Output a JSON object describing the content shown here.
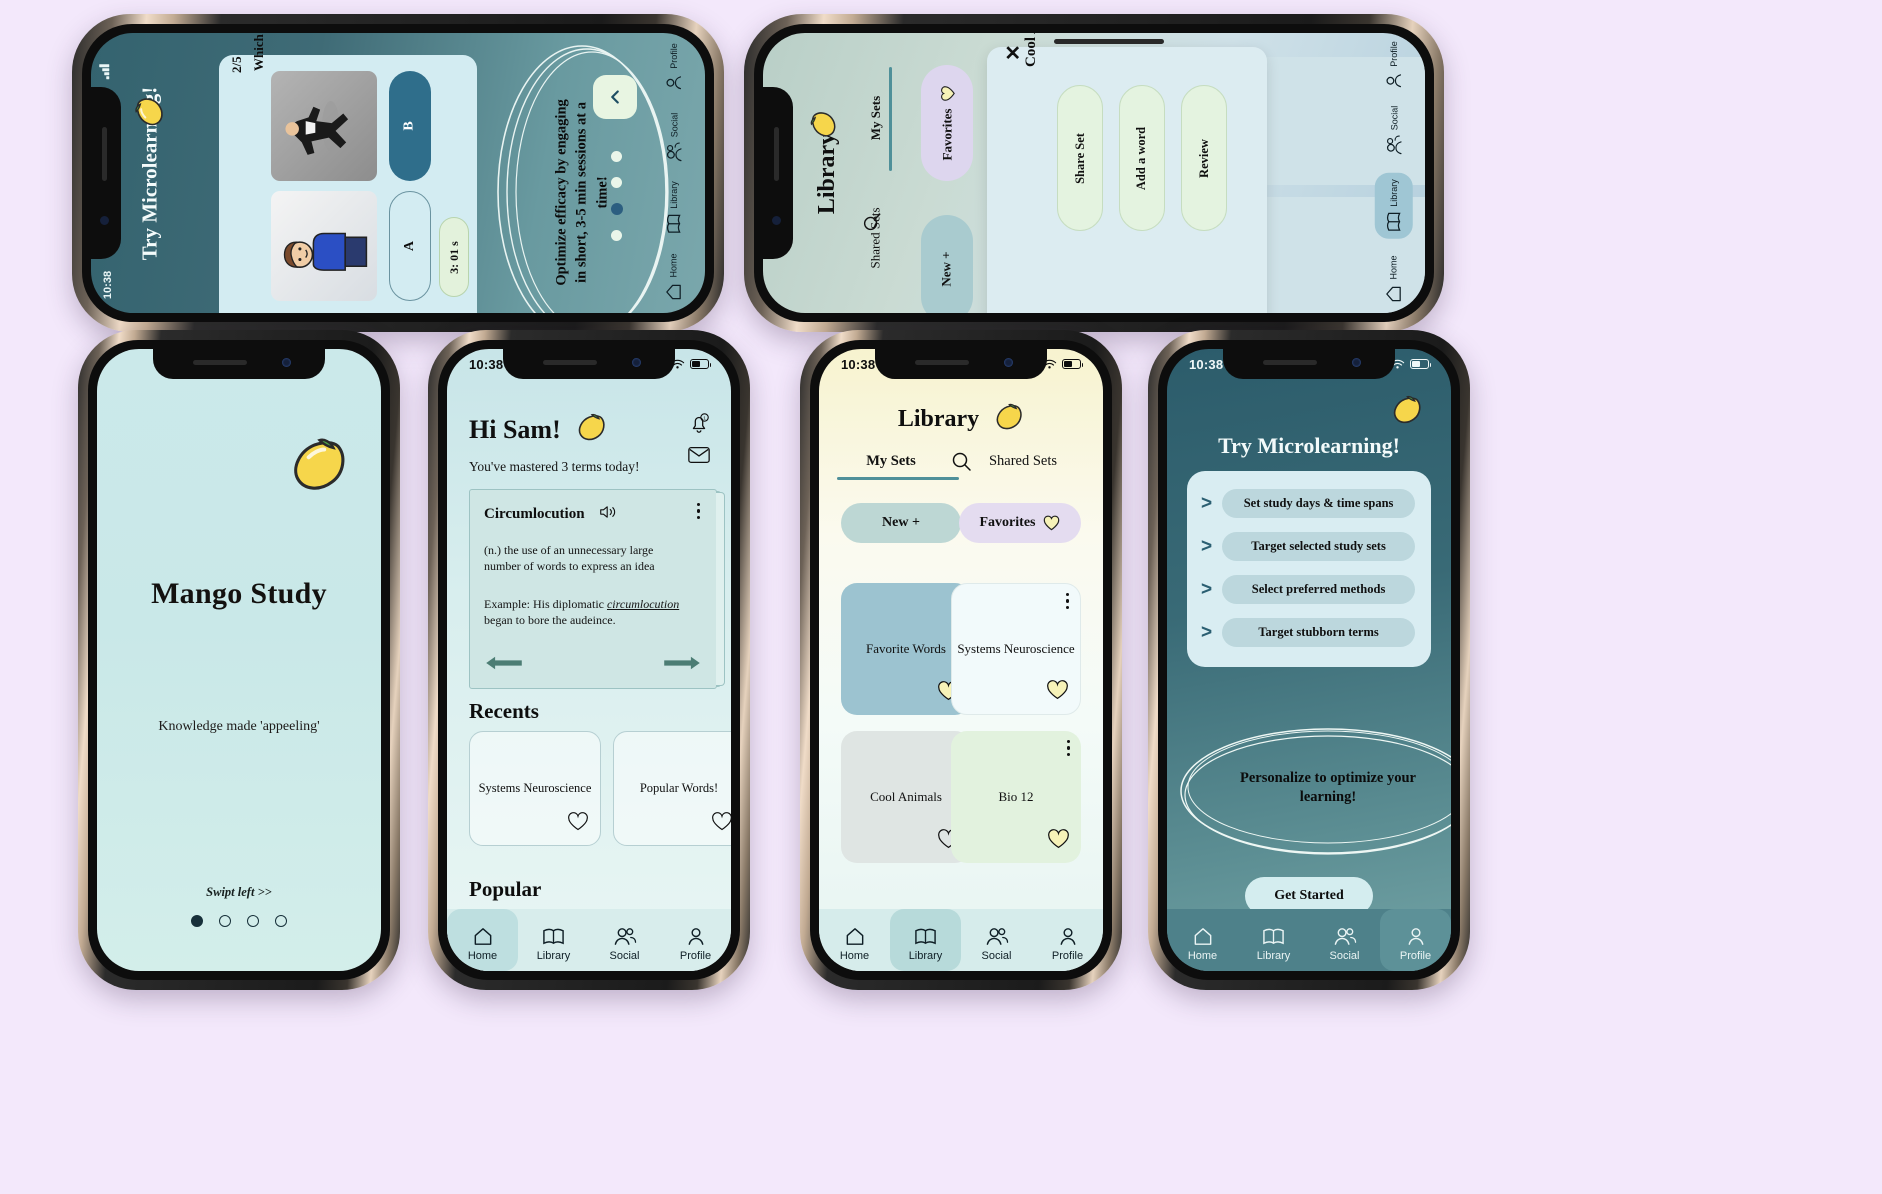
{
  "meta": {
    "page_background": "#f3e8fb",
    "brand_name": "Mango Study",
    "accent_teal": "#4f9099",
    "accent_dark": "#2c5c6b",
    "mango_yellow": "#f2d24b"
  },
  "status_bar": {
    "time": "10:38"
  },
  "nav": {
    "items": [
      {
        "label": "Home",
        "icon": "home-icon"
      },
      {
        "label": "Library",
        "icon": "book-icon"
      },
      {
        "label": "Social",
        "icon": "people-icon"
      },
      {
        "label": "Profile",
        "icon": "person-icon"
      }
    ]
  },
  "phone1_microlearning_landscape": {
    "status_time": "10:38",
    "title": "Try Microlearning!",
    "mango_icon": "mango-icon",
    "quiz": {
      "progress": "2/5",
      "question": "Which image portrays 'elation' best?",
      "option_a_label": "A",
      "option_b_label": "B",
      "timer": "3: 01 s",
      "image_a_alt": "cartoon person in blue shirt",
      "image_b_alt": "man in suit jumping on grey background"
    },
    "tip": "Optimize efficacy by engaging in short, 3-5 min sessions  at a time!",
    "collapse_icon": "chevron-up-icon",
    "carousel": {
      "total": 4,
      "active_index": 3
    },
    "active_nav": "Home"
  },
  "phone2_library_landscape": {
    "title": "Library",
    "mango_icon": "mango-icon",
    "tabs": [
      {
        "label": "My Sets",
        "active": true
      },
      {
        "label": "Shared Sets",
        "active": false
      }
    ],
    "search_icon": "search-icon",
    "buttons": [
      {
        "label": "New  +"
      },
      {
        "label": "Favorites",
        "icon": "heart-icon"
      }
    ],
    "modal": {
      "title": "Cool Animals",
      "close_icon": "close-icon",
      "actions": [
        "Share Set",
        "Add a word",
        "Review"
      ]
    },
    "background_cards": [
      "card-1",
      "card-2"
    ],
    "active_nav": "Library"
  },
  "phone3_splash": {
    "app_title": "Mango Study",
    "tagline": "Knowledge made 'appeeling'",
    "swipe_hint": "Swipt left >>",
    "mango_icon": "mango-icon",
    "carousel": {
      "total": 4,
      "active_index": 0
    }
  },
  "phone4_home": {
    "status_time": "10:38",
    "greeting": "Hi Sam!",
    "mango_icon": "mango-icon",
    "subtitle": "You've mastered 3 terms today!",
    "notification_icon": "bell-icon",
    "mail_icon": "envelope-icon",
    "flashcard": {
      "term": "Circumlocution",
      "audio_icon": "speaker-icon",
      "kebab_icon": "kebab-menu-icon",
      "definition": "(n.) the use of an unnecessary large number of words to express an idea",
      "example_prefix": "Example: His diplomatic ",
      "example_italic": "circumlocution",
      "example_suffix": " began to bore the audeince.",
      "prev_icon": "arrow-left-icon",
      "next_icon": "arrow-right-icon"
    },
    "recents": {
      "heading": "Recents",
      "cards": [
        {
          "title": "Systems Neuroscience",
          "favorited": false
        },
        {
          "title": "Popular Words!",
          "favorited": false
        }
      ]
    },
    "popular": {
      "heading": "Popular"
    },
    "active_nav": "Home"
  },
  "phone5_library": {
    "status_time": "10:38",
    "title": "Library",
    "mango_icon": "mango-icon",
    "tabs": [
      {
        "label": "My Sets",
        "active": true
      },
      {
        "label": "Shared Sets",
        "active": false
      }
    ],
    "search_icon": "search-icon",
    "new_button": "New  +",
    "favorites_button": "Favorites",
    "favorites_icon": "heart-icon",
    "sets": [
      {
        "title": "Favorite Words",
        "color": "#9cc3d0",
        "favorited": true
      },
      {
        "title": "Systems Neuroscience",
        "color": "#f2fafb",
        "favorited": true
      },
      {
        "title": "Cool Animals",
        "color": "#dfe5e3",
        "favorited": false
      },
      {
        "title": "Bio 12",
        "color": "#e2f2de",
        "favorited": true
      }
    ],
    "active_nav": "Library"
  },
  "phone6_microlearning": {
    "status_time": "10:38",
    "title": "Try Microlearning!",
    "mango_icon": "mango-icon",
    "options": [
      "Set study days & time spans",
      "Target selected study sets",
      "Select preferred methods",
      "Target stubborn terms"
    ],
    "chevron_icon": "chevron-right-icon",
    "ellipse_text": "Personalize to optimize your learning!",
    "cta": "Get Started",
    "active_nav": "Profile"
  }
}
